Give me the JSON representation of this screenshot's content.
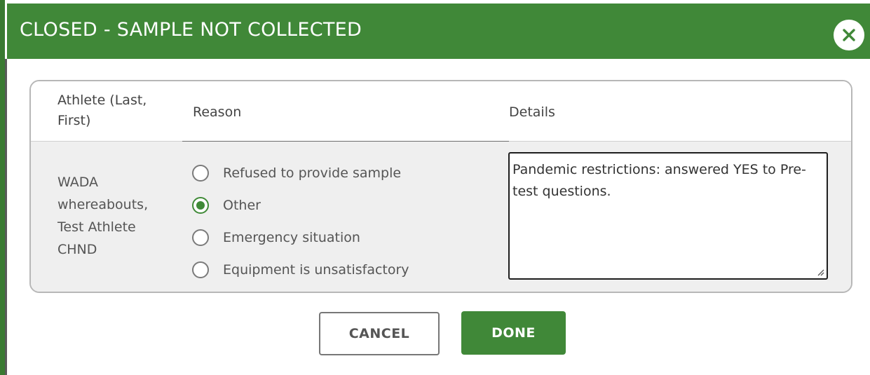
{
  "dialog": {
    "title": "CLOSED - SAMPLE NOT COLLECTED",
    "close_icon": "close-icon",
    "accent_color": "#408838"
  },
  "table": {
    "headers": {
      "athlete": "Athlete (Last, First)",
      "reason": "Reason",
      "details": "Details"
    },
    "row": {
      "athlete": "WADA whereabouts, Test Athlete CHND",
      "reasons": [
        {
          "label": "Refused to provide sample",
          "checked": false
        },
        {
          "label": "Other",
          "checked": true
        },
        {
          "label": "Emergency situation",
          "checked": false
        },
        {
          "label": "Equipment is unsatisfactory",
          "checked": false
        }
      ],
      "details": "Pandemic restrictions: answered YES to Pre-test questions."
    }
  },
  "buttons": {
    "cancel": "CANCEL",
    "done": "DONE"
  }
}
